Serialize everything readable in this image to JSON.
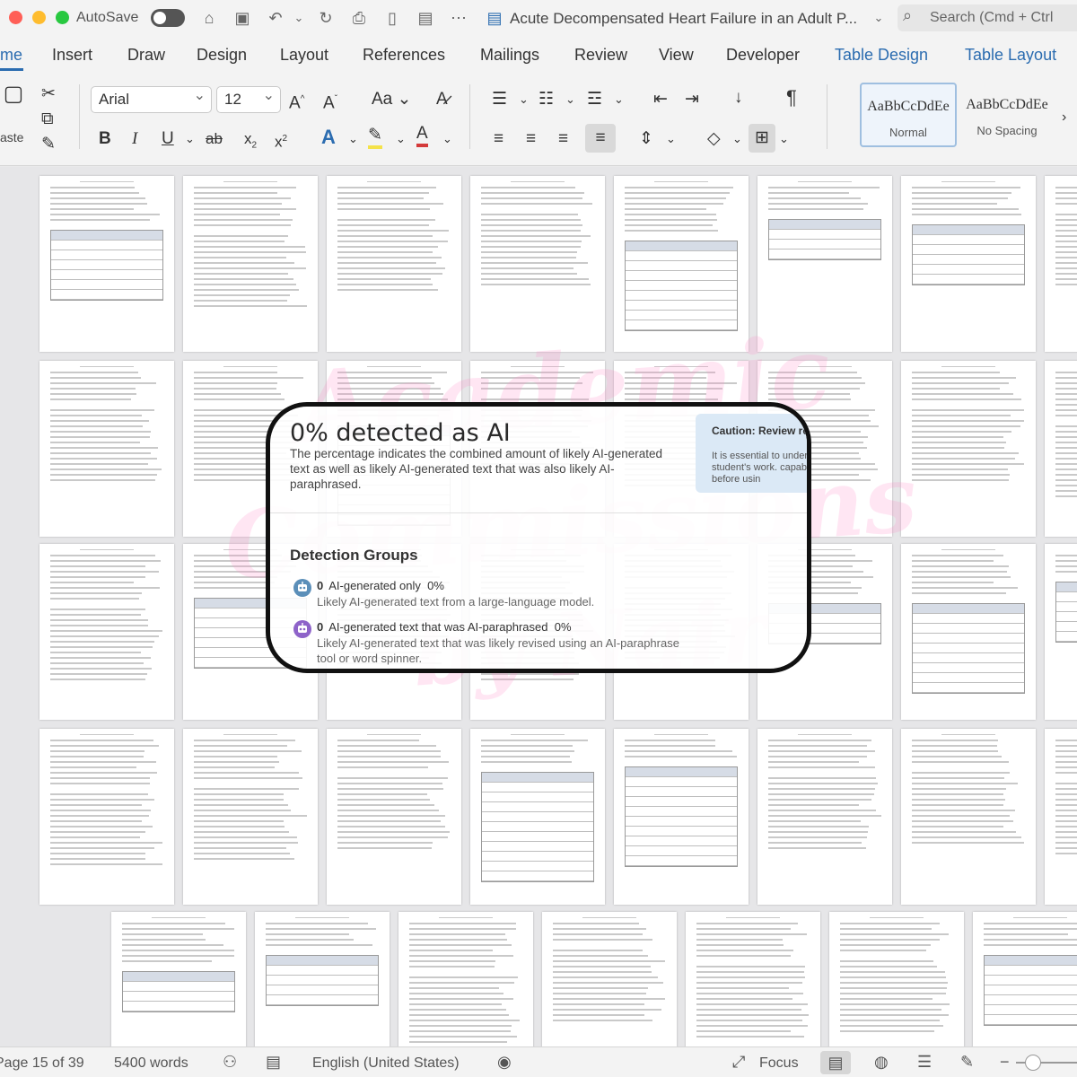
{
  "window": {
    "autosave_label": "AutoSave",
    "document_title": "Acute Decompensated Heart Failure in an Adult P...",
    "search_placeholder": "Search (Cmd + Ctrl"
  },
  "ribbon_tabs": [
    {
      "label": "me",
      "active": true
    },
    {
      "label": "Insert"
    },
    {
      "label": "Draw"
    },
    {
      "label": "Design"
    },
    {
      "label": "Layout"
    },
    {
      "label": "References"
    },
    {
      "label": "Mailings"
    },
    {
      "label": "Review"
    },
    {
      "label": "View"
    },
    {
      "label": "Developer"
    },
    {
      "label": "Table Design",
      "contextual": true
    },
    {
      "label": "Table Layout",
      "contextual": true
    }
  ],
  "ribbon": {
    "paste_label": "aste",
    "font_name": "Arial",
    "font_size": "12",
    "change_case": "Aa",
    "styles": [
      {
        "sample": "AaBbCcDdEe",
        "name": "Normal",
        "selected": true
      },
      {
        "sample": "AaBbCcDdEe",
        "name": "No Spacing"
      }
    ]
  },
  "detection": {
    "headline": "0% detected as AI",
    "description": "The percentage indicates the combined amount of likely AI-generated text as well as likely AI-generated text that was also likely AI-paraphrased.",
    "caution_title": "Caution: Review requ",
    "caution_body": "It is essential to unders about a student's work. capabilities before usin",
    "groups_heading": "Detection Groups",
    "groups": [
      {
        "count": "0",
        "title": "AI-generated only",
        "percent": "0%",
        "desc": "Likely AI-generated text from a large-language model.",
        "color": "#5b8fb9"
      },
      {
        "count": "0",
        "title": "AI-generated text that was AI-paraphrased",
        "percent": "0%",
        "desc": "Likely AI-generated text that was likely revised using an AI-paraphrase tool or word spinner.",
        "color": "#8e63c9"
      }
    ]
  },
  "watermark": {
    "line1": "Academic",
    "line2": "Commissions",
    "line3": "by Nair"
  },
  "status": {
    "page": "Page 15 of 39",
    "words": "5400 words",
    "language": "English (United States)",
    "focus": "Focus"
  },
  "colors": {
    "accent": "#2b6cb0",
    "close": "#ff5f57",
    "minimize": "#febc2e",
    "maximize": "#28c840"
  }
}
